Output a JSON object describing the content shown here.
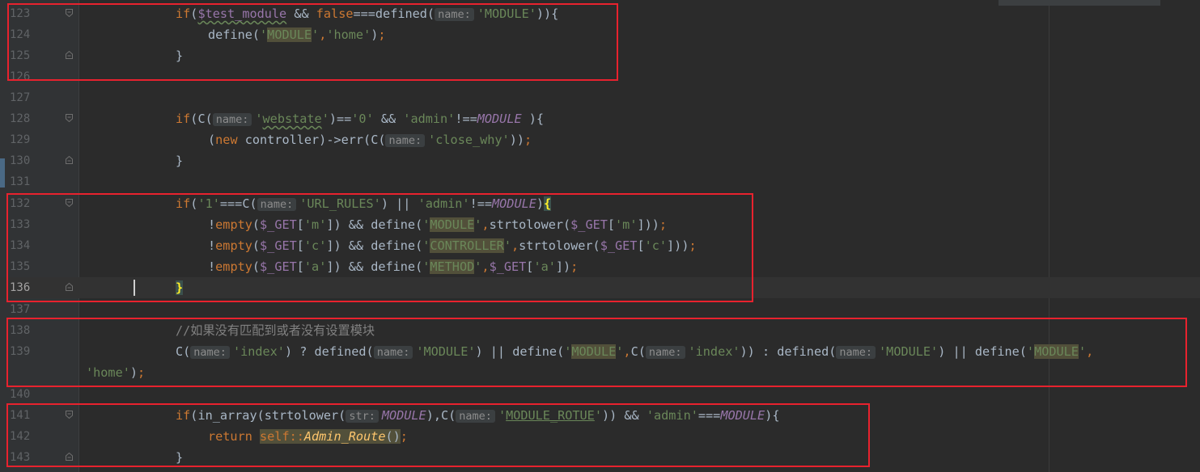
{
  "editor": {
    "line_numbers": [
      "123",
      "124",
      "125",
      "126",
      "127",
      "128",
      "129",
      "130",
      "131",
      "132",
      "133",
      "134",
      "135",
      "136",
      "137",
      "138",
      "139",
      "",
      "140",
      "141",
      "142",
      "143"
    ],
    "lines": [
      {
        "num": "123",
        "parts": [
          [
            "kw",
            "if"
          ],
          [
            "p",
            "("
          ],
          [
            "var wavy",
            "$test_module"
          ],
          [
            "p",
            " && "
          ],
          [
            "kw",
            "false"
          ],
          [
            "p",
            "===defined("
          ],
          [
            "hint",
            "name:"
          ],
          [
            "str",
            "'MODULE'"
          ],
          [
            "p",
            "))"
          ],
          [
            "p",
            "{"
          ]
        ]
      },
      {
        "num": "124",
        "parts": [
          [
            "p",
            "define("
          ],
          [
            "str",
            "'"
          ],
          [
            "str hl",
            "MODULE"
          ],
          [
            "str",
            "'"
          ],
          [
            "kw",
            ","
          ],
          [
            "str",
            "'home'"
          ],
          [
            "p",
            ")"
          ],
          [
            "kw",
            ";"
          ]
        ]
      },
      {
        "num": "125",
        "parts": [
          [
            "p",
            "}"
          ]
        ]
      },
      {
        "num": "126",
        "parts": []
      },
      {
        "num": "127",
        "parts": []
      },
      {
        "num": "128",
        "parts": [
          [
            "kw",
            "if"
          ],
          [
            "p",
            "(C("
          ],
          [
            "hint",
            "name:"
          ],
          [
            "str",
            "'"
          ],
          [
            "str wavy",
            "webstate"
          ],
          [
            "str",
            "'"
          ],
          [
            "p",
            ")=="
          ],
          [
            "str",
            "'0'"
          ],
          [
            "p",
            " && "
          ],
          [
            "str",
            "'admin'"
          ],
          [
            "p",
            "!=="
          ],
          [
            "const",
            "MODULE"
          ],
          [
            "p",
            " ){"
          ]
        ]
      },
      {
        "num": "129",
        "parts": [
          [
            "p",
            "("
          ],
          [
            "kw",
            "new "
          ],
          [
            "p",
            "controller)->"
          ],
          [
            "p",
            "err"
          ],
          [
            "p",
            "(C("
          ],
          [
            "hint",
            "name:"
          ],
          [
            "str",
            "'close_why'"
          ],
          [
            "p",
            "))"
          ],
          [
            "kw",
            ";"
          ]
        ]
      },
      {
        "num": "130",
        "parts": [
          [
            "p",
            "}"
          ]
        ]
      },
      {
        "num": "131",
        "parts": []
      },
      {
        "num": "132",
        "parts": [
          [
            "kw",
            "if"
          ],
          [
            "p",
            "("
          ],
          [
            "str",
            "'1'"
          ],
          [
            "p",
            "===C("
          ],
          [
            "hint",
            "name:"
          ],
          [
            "str",
            "'URL_RULES'"
          ],
          [
            "p",
            ") || "
          ],
          [
            "str",
            "'admin'"
          ],
          [
            "p",
            "!=="
          ],
          [
            "const",
            "MODULE"
          ],
          [
            "p",
            ")"
          ],
          [
            "brace-hl",
            "{"
          ]
        ]
      },
      {
        "num": "133",
        "parts": [
          [
            "p",
            "!"
          ],
          [
            "kw",
            "empty"
          ],
          [
            "p",
            "("
          ],
          [
            "var",
            "$_GET"
          ],
          [
            "p",
            "["
          ],
          [
            "str",
            "'m'"
          ],
          [
            "p",
            "]) && define("
          ],
          [
            "str",
            "'"
          ],
          [
            "str hl",
            "MODULE"
          ],
          [
            "str",
            "'"
          ],
          [
            "kw",
            ","
          ],
          [
            "p",
            "strtolower("
          ],
          [
            "var",
            "$_GET"
          ],
          [
            "p",
            "["
          ],
          [
            "str",
            "'m'"
          ],
          [
            "p",
            "]))"
          ],
          [
            "kw",
            ";"
          ]
        ]
      },
      {
        "num": "134",
        "parts": [
          [
            "p",
            "!"
          ],
          [
            "kw",
            "empty"
          ],
          [
            "p",
            "("
          ],
          [
            "var",
            "$_GET"
          ],
          [
            "p",
            "["
          ],
          [
            "str",
            "'c'"
          ],
          [
            "p",
            "]) && define("
          ],
          [
            "str",
            "'"
          ],
          [
            "str hl",
            "CONTROLLER"
          ],
          [
            "str",
            "'"
          ],
          [
            "kw",
            ","
          ],
          [
            "p",
            "strtolower("
          ],
          [
            "var",
            "$_GET"
          ],
          [
            "p",
            "["
          ],
          [
            "str",
            "'c'"
          ],
          [
            "p",
            "]))"
          ],
          [
            "kw",
            ";"
          ]
        ]
      },
      {
        "num": "135",
        "parts": [
          [
            "p",
            "!"
          ],
          [
            "kw",
            "empty"
          ],
          [
            "p",
            "("
          ],
          [
            "var",
            "$_GET"
          ],
          [
            "p",
            "["
          ],
          [
            "str",
            "'a'"
          ],
          [
            "p",
            "]) && define("
          ],
          [
            "str",
            "'"
          ],
          [
            "str hl",
            "METHOD"
          ],
          [
            "str",
            "'"
          ],
          [
            "kw",
            ","
          ],
          [
            "var",
            "$_GET"
          ],
          [
            "p",
            "["
          ],
          [
            "str",
            "'a'"
          ],
          [
            "p",
            "])"
          ],
          [
            "kw",
            ";"
          ]
        ]
      },
      {
        "num": "136",
        "parts": [
          [
            "brace-hl",
            "}"
          ]
        ]
      },
      {
        "num": "137",
        "parts": []
      },
      {
        "num": "138",
        "parts": [
          [
            "cmt",
            "//如果没有匹配到或者没有设置模块"
          ]
        ]
      },
      {
        "num": "139",
        "parts": [
          [
            "p",
            "C("
          ],
          [
            "hint",
            "name:"
          ],
          [
            "str",
            "'index'"
          ],
          [
            "p",
            ") ? defined("
          ],
          [
            "hint",
            "name:"
          ],
          [
            "str",
            "'MODULE'"
          ],
          [
            "p",
            ") || define("
          ],
          [
            "str",
            "'"
          ],
          [
            "str hl",
            "MODULE"
          ],
          [
            "str",
            "'"
          ],
          [
            "kw",
            ","
          ],
          [
            "p",
            "C("
          ],
          [
            "hint",
            "name:"
          ],
          [
            "str",
            "'index'"
          ],
          [
            "p",
            ")) : defined("
          ],
          [
            "hint",
            "name:"
          ],
          [
            "str",
            "'MODULE'"
          ],
          [
            "p",
            ") || define("
          ],
          [
            "str",
            "'"
          ],
          [
            "str hl",
            "MODULE"
          ],
          [
            "str",
            "'"
          ],
          [
            "kw",
            ","
          ]
        ]
      },
      {
        "num": "",
        "parts": [
          [
            "str",
            "'home'"
          ],
          [
            "p",
            ")"
          ],
          [
            "kw",
            ";"
          ]
        ]
      },
      {
        "num": "140",
        "parts": []
      },
      {
        "num": "141",
        "parts": [
          [
            "kw",
            "if"
          ],
          [
            "p",
            "(in_array(strtolower("
          ],
          [
            "hint",
            "str:"
          ],
          [
            "const",
            "MODULE"
          ],
          [
            "p",
            "),C("
          ],
          [
            "hint",
            "name:"
          ],
          [
            "str",
            "'"
          ],
          [
            "str under",
            "MODULE_ROTUE"
          ],
          [
            "str",
            "'"
          ],
          [
            "p",
            ")) && "
          ],
          [
            "str",
            "'admin'"
          ],
          [
            "p",
            "==="
          ],
          [
            "const",
            "MODULE"
          ],
          [
            "p",
            "){"
          ]
        ]
      },
      {
        "num": "142",
        "parts": [
          [
            "kw",
            "return "
          ],
          [
            "kw hl",
            "self"
          ],
          [
            "kw hl",
            "::"
          ],
          [
            "fn hl",
            "Admin_Route"
          ],
          [
            "p hl",
            "()"
          ],
          [
            "kw",
            ";"
          ]
        ]
      },
      {
        "num": "143",
        "parts": [
          [
            "p",
            "}"
          ]
        ]
      }
    ]
  }
}
